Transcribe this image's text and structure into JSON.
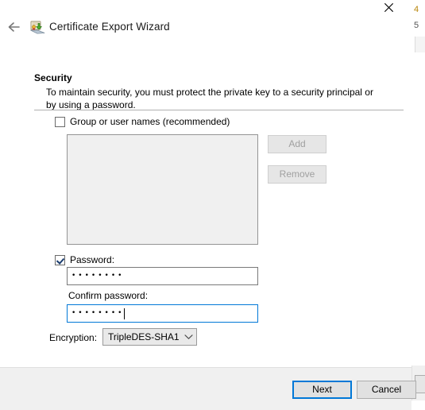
{
  "window": {
    "title": "Certificate Export Wizard",
    "back_icon": "back-arrow-icon",
    "wizard_icon": "certificate-export-icon",
    "close_icon": "close-icon"
  },
  "background_window": {
    "fragment_top": "4",
    "fragment_second": "5"
  },
  "page": {
    "heading": "Security",
    "description": "To maintain security, you must protect the private key to a security principal or by using a password."
  },
  "group_names": {
    "checkbox_label": "Group or user names (recommended)",
    "checked": false,
    "list_items": [],
    "add_label": "Add",
    "remove_label": "Remove",
    "add_enabled": false,
    "remove_enabled": false
  },
  "password": {
    "checkbox_label": "Password:",
    "checked": true,
    "value": "••••••••",
    "confirm_label": "Confirm password:",
    "confirm_value": "••••••••",
    "confirm_focused": true
  },
  "encryption": {
    "label": "Encryption:",
    "selected": "TripleDES-SHA1",
    "chevron_icon": "chevron-down-icon",
    "options": [
      "TripleDES-SHA1"
    ]
  },
  "footer": {
    "next_label": "Next",
    "cancel_label": "Cancel",
    "default_button": "Next"
  },
  "colors": {
    "accent": "#0078d7",
    "footer_bg": "#f0f0f0",
    "listbox_bg": "#f0f0f0",
    "disabled_text": "#a0a0a0"
  }
}
